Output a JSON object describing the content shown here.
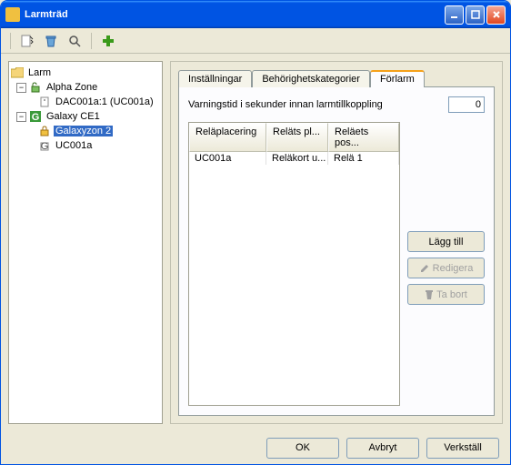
{
  "window": {
    "title": "Larmträd"
  },
  "toolbar": {},
  "tree": {
    "root": "Larm",
    "n1": "Alpha Zone",
    "n1a": "DAC001a:1 (UC001a)",
    "n2": "Galaxy CE1",
    "n2a": "Galaxyzon 2",
    "n2b": "UC001a"
  },
  "tabs": {
    "t1": "Inställningar",
    "t2": "Behörighetskategorier",
    "t3": "Förlarm"
  },
  "panel": {
    "warning_label": "Varningstid i sekunder innan larmtillkoppling",
    "warning_value": "0",
    "headers": {
      "c1": "Reläplacering",
      "c2": "Reläts pl...",
      "c3": "Reläets pos..."
    },
    "row1": {
      "c1": "UC001a",
      "c2": "Reläkort u...",
      "c3": "Relä 1"
    },
    "btn_add": "Lägg till",
    "btn_edit": "Redigera",
    "btn_del": "Ta bort"
  },
  "footer": {
    "ok": "OK",
    "cancel": "Avbryt",
    "apply": "Verkställ"
  }
}
